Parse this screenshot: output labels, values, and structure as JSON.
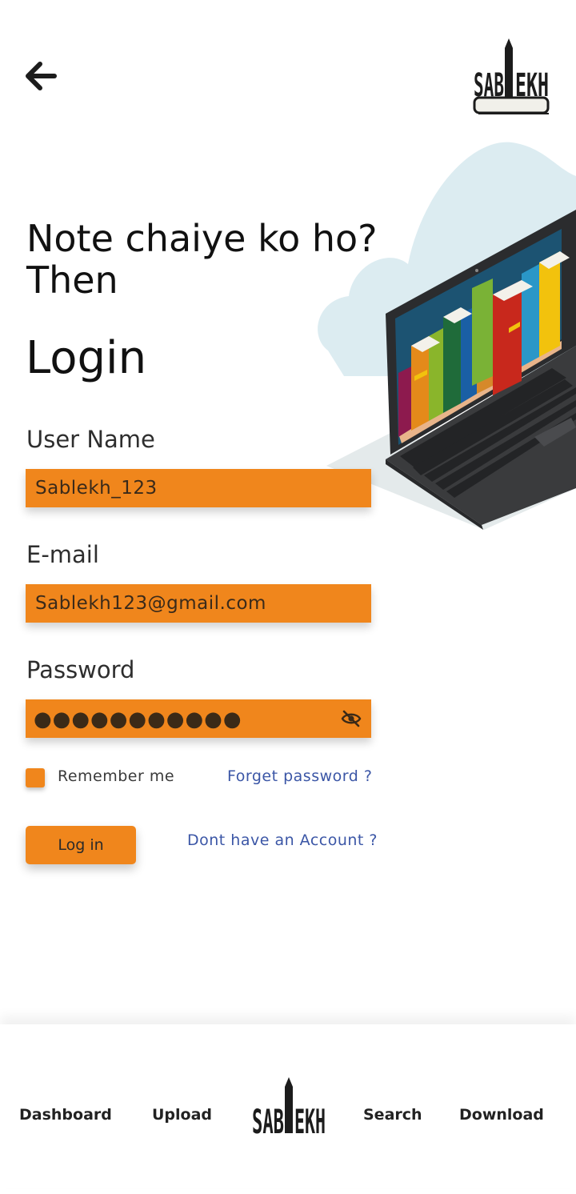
{
  "header": {
    "back_icon": "arrow-left-icon",
    "logo_text": "SABLEKH"
  },
  "hero": {
    "tagline_line1": "Note chaiye ko ho?",
    "tagline_line2": "Then",
    "title": "Login"
  },
  "form": {
    "username_label": "User Name",
    "username_value": "Sablekh_123",
    "email_label": "E-mail",
    "email_value": "Sablekh123@gmail.com",
    "password_label": "Password",
    "password_masked": "●●●●●●●●●●●",
    "password_visibility_icon": "eye-off-icon",
    "remember_label": "Remember me",
    "forget_link": "Forget password ?",
    "login_button": "Log in",
    "signup_link": "Dont have an Account ?"
  },
  "bottom_nav": {
    "items": [
      "Dashboard",
      "Upload",
      "Search",
      "Download"
    ],
    "center_logo_text": "SABLEKH"
  },
  "colors": {
    "accent": "#f0861c",
    "link": "#3b56a6",
    "text": "#1b1b1b"
  }
}
